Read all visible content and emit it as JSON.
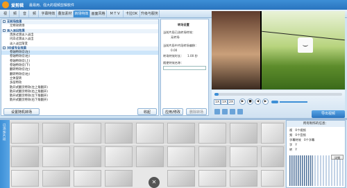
{
  "app": {
    "title": "爱剪辑",
    "subtitle": "最易用、强大的视频剪辑软件"
  },
  "tabs": [
    {
      "label": "视"
    },
    {
      "label": "频"
    },
    {
      "label": "音"
    },
    {
      "label": "频"
    },
    {
      "label": "字幕特效"
    },
    {
      "label": "叠加素材"
    },
    {
      "label": "转场特效"
    },
    {
      "label": "画面风格"
    },
    {
      "label": "M T V"
    },
    {
      "label": "卡拉OK"
    },
    {
      "label": "升级与服务"
    }
  ],
  "effects_tree": [
    {
      "label": "无转场效果",
      "type": "category"
    },
    {
      "label": "无特效转场",
      "type": "item"
    },
    {
      "label": "淡入淡出效果",
      "type": "category"
    },
    {
      "label": "黑屏过渡淡入淡出",
      "type": "item"
    },
    {
      "label": "闪白过渡淡入淡出",
      "type": "item"
    },
    {
      "label": "淡入淡出渐变",
      "type": "item"
    },
    {
      "label": "3D或专业效果",
      "type": "category"
    },
    {
      "label": "卷轴特效切(左)",
      "type": "item",
      "selected": true
    },
    {
      "label": "卷轴特效切(右)",
      "type": "item"
    },
    {
      "label": "卷轴特效切(上)",
      "type": "item"
    },
    {
      "label": "卷轴特效切(下)",
      "type": "item"
    },
    {
      "label": "翻转特效切(左)",
      "type": "item"
    },
    {
      "label": "翻转特效切(右)",
      "type": "item"
    },
    {
      "label": "立体旋转",
      "type": "item"
    },
    {
      "label": "多层特效",
      "type": "item"
    },
    {
      "label": "散开式翻页特效(左上角翻开)",
      "type": "item"
    },
    {
      "label": "散开式翻页特效(右上角翻开)",
      "type": "item"
    },
    {
      "label": "散开式翻页特效(左下角翻开)",
      "type": "item"
    },
    {
      "label": "散开式翻页特效(右下角翻开)",
      "type": "item"
    }
  ],
  "left_buttons": {
    "favorites": "设置随机转场",
    "collapse": "收起"
  },
  "settings": {
    "header": "转场设置",
    "type_label": "当前片段已选转场特效：",
    "type_value": "无转场",
    "offset_label": "当前片段中片段转场偏移：",
    "offset_value": "0.00",
    "duration_label": "转场特效时长：",
    "duration_value": "1.00 秒",
    "duration_suffix": "秒",
    "random_label": "随便特效名称：",
    "apply_button": "应用/修改",
    "delete_button": "删除转场"
  },
  "player": {
    "rate_1": "1X",
    "rate_2": "1X",
    "rate_3": "2X",
    "progress_pct": 3,
    "play_icon": "play-icon",
    "export_label": "导出视频"
  },
  "side_tab": {
    "label": "已添加片段"
  },
  "info_panel": {
    "title": "所有制作的信息：",
    "rows": [
      {
        "k": "视",
        "v": "0个视频"
      },
      {
        "k": "频",
        "v": "0个音频"
      },
      {
        "k": "字幕特效",
        "v": "0个字幕"
      },
      {
        "k": "字",
        "v": "Y"
      },
      {
        "k": "转",
        "v": "Y"
      }
    ],
    "dismiss": "详细"
  },
  "colors": {
    "accent": "#3d8fd6",
    "titlebar": "#2a74bf",
    "background": "#cfe3f3"
  }
}
